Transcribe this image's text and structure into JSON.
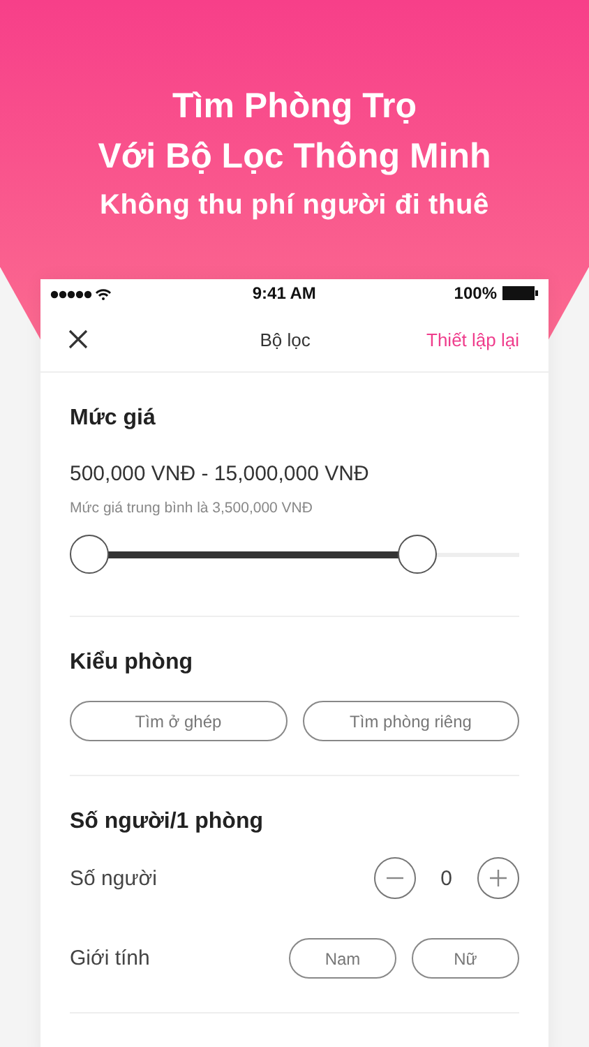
{
  "headline": {
    "lines": [
      "Tìm Phòng Trọ",
      "Với Bộ Lọc Thông Minh"
    ],
    "subtitle": "Không thu phí người đi thuê"
  },
  "status_bar": {
    "time": "9:41 AM",
    "battery": "100%"
  },
  "nav": {
    "title": "Bộ lọc",
    "action": "Thiết lập lại"
  },
  "price": {
    "title": "Mức giá",
    "range": "500,000 VNĐ - 15,000,000 VNĐ",
    "note": "Mức giá trung bình là 3,500,000 VNĐ",
    "thumbs": [
      {
        "level": 0
      },
      {
        "level": 0.8
      }
    ]
  },
  "room_type": {
    "title": "Kiểu phòng",
    "options": [
      {
        "label": "Tìm ở ghép",
        "selected": false
      },
      {
        "label": "Tìm phòng riêng",
        "selected": false
      }
    ]
  },
  "occupants": {
    "title": "Số người/1 phòng",
    "count_label": "Số người",
    "count": "0",
    "gender_label": "Giới tính",
    "genders": [
      {
        "label": "Nam",
        "selected": false
      },
      {
        "label": "Nữ",
        "selected": false
      }
    ]
  }
}
